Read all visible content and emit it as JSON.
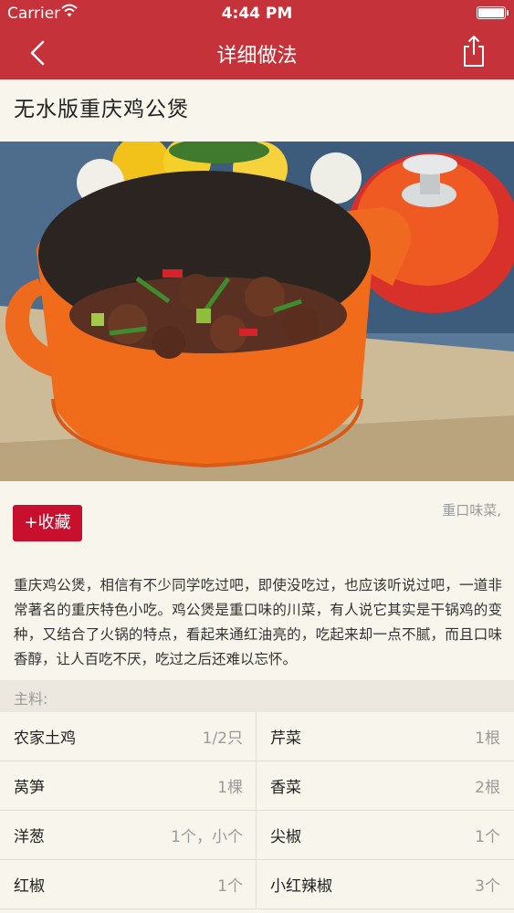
{
  "status_bar": {
    "carrier": "Carrier",
    "time": "4:44 PM"
  },
  "nav": {
    "title": "详细做法"
  },
  "recipe": {
    "title": "无水版重庆鸡公煲",
    "favorite_label": "+收藏",
    "tags": "重口味菜,",
    "description": "重庆鸡公煲，相信有不少同学吃过吧，即使没吃过，也应该听说过吧，一道非常著名的重庆特色小吃。鸡公煲是重口味的川菜，有人说它其实是干锅鸡的变种，又结合了火锅的特点，看起来通红油亮的，吃起来却一点不腻，而且口味香醇，让人百吃不厌，吃过之后还难以忘怀。"
  },
  "ingredients": {
    "header": "主料:",
    "rows": [
      [
        {
          "name": "农家土鸡",
          "amount": "1/2只"
        },
        {
          "name": "芹菜",
          "amount": "1根"
        }
      ],
      [
        {
          "name": "莴笋",
          "amount": "1棵"
        },
        {
          "name": "香菜",
          "amount": "2根"
        }
      ],
      [
        {
          "name": "洋葱",
          "amount": "1个，小个"
        },
        {
          "name": "尖椒",
          "amount": "1个"
        }
      ],
      [
        {
          "name": "红椒",
          "amount": "1个"
        },
        {
          "name": "小红辣椒",
          "amount": "3个"
        }
      ]
    ]
  },
  "colors": {
    "brand_red": "#c5323a",
    "button_red": "#c8102e",
    "background": "#f8f5ec"
  }
}
